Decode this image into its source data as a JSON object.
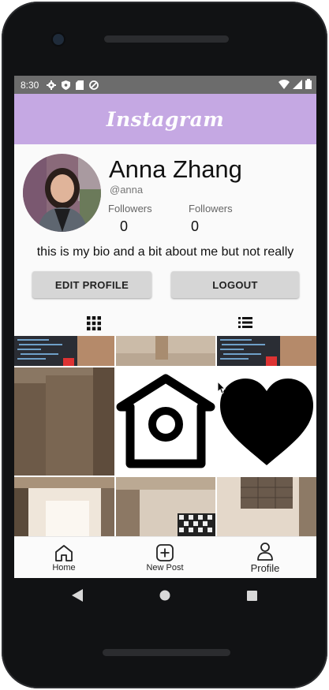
{
  "status_bar": {
    "time": "8:30"
  },
  "app_bar": {
    "title": "Instagram"
  },
  "profile": {
    "name": "Anna Zhang",
    "handle": "@anna",
    "stats": [
      {
        "label": "Followers",
        "value": "0"
      },
      {
        "label": "Followers",
        "value": "0"
      }
    ],
    "bio": "this is my bio and a bit about me but not really"
  },
  "buttons": {
    "edit_profile": "EDIT PROFILE",
    "logout": "LOGOUT"
  },
  "tabs": [
    {
      "icon": "grid-icon",
      "active": true
    },
    {
      "icon": "list-icon",
      "active": false
    }
  ],
  "bottom_nav": [
    {
      "label": "Home",
      "icon": "home-icon"
    },
    {
      "label": "New Post",
      "icon": "add-box-icon"
    },
    {
      "label": "Profile",
      "icon": "person-icon"
    }
  ],
  "colors": {
    "app_bar": "#c5a8e3",
    "status_bar": "#6c6c6c",
    "button_bg": "#d6d6d6"
  }
}
